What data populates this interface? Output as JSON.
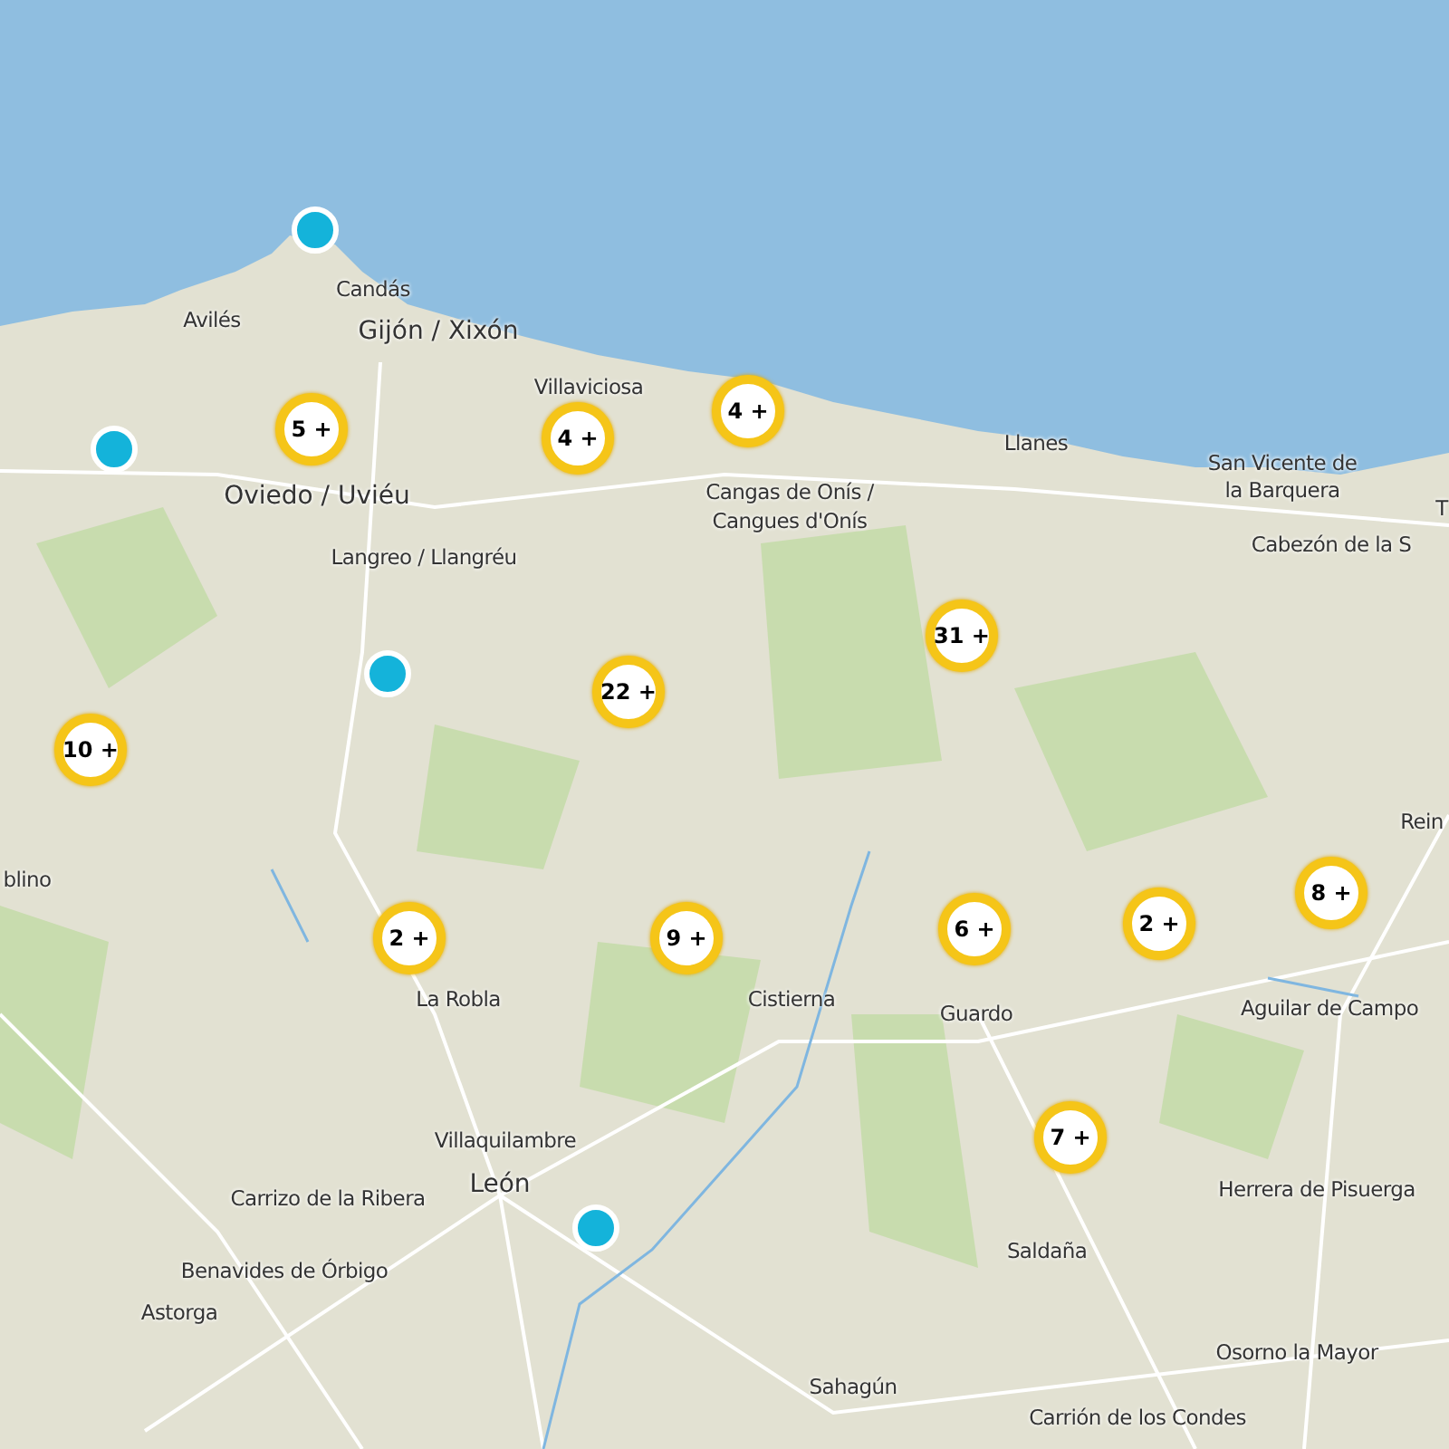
{
  "places": [
    {
      "name": "Candás",
      "kind": "town"
    },
    {
      "name": "Avilés",
      "kind": "town"
    },
    {
      "name": "Gijón / Xixón",
      "kind": "city"
    },
    {
      "name": "Villaviciosa",
      "kind": "town"
    },
    {
      "name": "Oviedo / Uviéu",
      "kind": "city"
    },
    {
      "name": "Langreo / Llangréu",
      "kind": "town"
    },
    {
      "name": "Cangas de Onís /",
      "kind": "town"
    },
    {
      "name": "Cangues d'Onís",
      "kind": "town"
    },
    {
      "name": "Llanes",
      "kind": "town"
    },
    {
      "name": "San Vicente de",
      "kind": "town"
    },
    {
      "name": "la Barquera",
      "kind": "town"
    },
    {
      "name": "T",
      "kind": "town"
    },
    {
      "name": "Cabezón de la S",
      "kind": "town"
    },
    {
      "name": "Rein",
      "kind": "town"
    },
    {
      "name": "blino",
      "kind": "town"
    },
    {
      "name": "La Robla",
      "kind": "town"
    },
    {
      "name": "Cistierna",
      "kind": "town"
    },
    {
      "name": "Guardo",
      "kind": "town"
    },
    {
      "name": "Aguilar de Campo",
      "kind": "town"
    },
    {
      "name": "Villaquilambre",
      "kind": "town"
    },
    {
      "name": "León",
      "kind": "city"
    },
    {
      "name": "Carrizo de la Ribera",
      "kind": "town"
    },
    {
      "name": "Herrera de Pisuerga",
      "kind": "town"
    },
    {
      "name": "Benavides de Órbigo",
      "kind": "town"
    },
    {
      "name": "Saldaña",
      "kind": "town"
    },
    {
      "name": "Astorga",
      "kind": "town"
    },
    {
      "name": "Osorno la Mayor",
      "kind": "town"
    },
    {
      "name": "Sahagún",
      "kind": "town"
    },
    {
      "name": "Carrión de los Condes",
      "kind": "town"
    }
  ],
  "markers": [
    {
      "kind": "single"
    },
    {
      "kind": "single"
    },
    {
      "kind": "cluster",
      "label": "5 +"
    },
    {
      "kind": "cluster",
      "label": "4 +"
    },
    {
      "kind": "cluster",
      "label": "4 +"
    },
    {
      "kind": "cluster",
      "label": "31 +"
    },
    {
      "kind": "single"
    },
    {
      "kind": "cluster",
      "label": "22 +"
    },
    {
      "kind": "cluster",
      "label": "10 +"
    },
    {
      "kind": "cluster",
      "label": "2 +"
    },
    {
      "kind": "cluster",
      "label": "9 +"
    },
    {
      "kind": "cluster",
      "label": "6 +"
    },
    {
      "kind": "cluster",
      "label": "2 +"
    },
    {
      "kind": "cluster",
      "label": "8 +"
    },
    {
      "kind": "cluster",
      "label": "7 +"
    },
    {
      "kind": "single"
    }
  ]
}
